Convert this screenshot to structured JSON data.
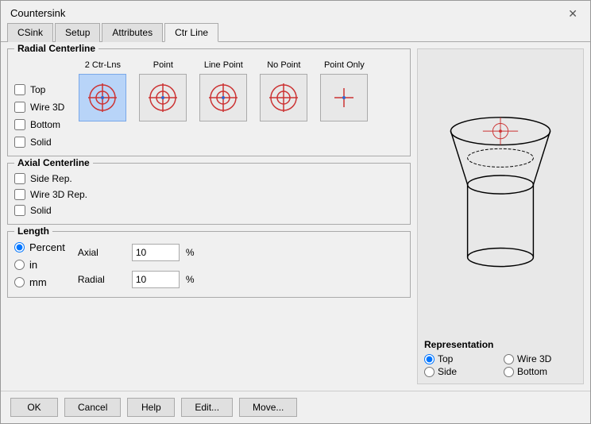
{
  "dialog": {
    "title": "Countersink",
    "close_label": "✕"
  },
  "tabs": [
    {
      "label": "CSink",
      "active": false
    },
    {
      "label": "Setup",
      "active": false
    },
    {
      "label": "Attributes",
      "active": false
    },
    {
      "label": "Ctr Line",
      "active": true
    }
  ],
  "radial_centerline": {
    "group_label": "Radial Centerline",
    "checkboxes": [
      {
        "id": "chk-top",
        "label": "Top",
        "checked": false
      },
      {
        "id": "chk-wire3d",
        "label": "Wire 3D",
        "checked": false
      },
      {
        "id": "chk-bottom",
        "label": "Bottom",
        "checked": false
      },
      {
        "id": "chk-solid",
        "label": "Solid",
        "checked": false
      }
    ],
    "icon_columns": [
      {
        "label": "2 Ctr-Lns",
        "selected": true
      },
      {
        "label": "Point",
        "selected": false
      },
      {
        "label": "Line Point",
        "selected": false
      },
      {
        "label": "No Point",
        "selected": false
      },
      {
        "label": "Point Only",
        "selected": false
      }
    ]
  },
  "axial_centerline": {
    "group_label": "Axial Centerline",
    "checkboxes": [
      {
        "id": "chk-siderep",
        "label": "Side Rep.",
        "checked": false
      },
      {
        "id": "chk-wire3drep",
        "label": "Wire 3D Rep.",
        "checked": false
      },
      {
        "id": "chk-solid2",
        "label": "Solid",
        "checked": false
      }
    ]
  },
  "length": {
    "group_label": "Length",
    "radios": [
      {
        "id": "rad-percent",
        "label": "Percent",
        "checked": true
      },
      {
        "id": "rad-in",
        "label": "in",
        "checked": false
      },
      {
        "id": "rad-mm",
        "label": "mm",
        "checked": false
      }
    ],
    "fields": [
      {
        "label": "Axial",
        "value": "10",
        "unit": "%"
      },
      {
        "label": "Radial",
        "value": "10",
        "unit": "%"
      }
    ]
  },
  "representation": {
    "label": "Representation",
    "radios": [
      {
        "id": "rep-top",
        "label": "Top",
        "checked": true
      },
      {
        "id": "rep-wire3d",
        "label": "Wire 3D",
        "checked": false
      },
      {
        "id": "rep-side",
        "label": "Side",
        "checked": false
      },
      {
        "id": "rep-bottom",
        "label": "Bottom",
        "checked": false
      }
    ]
  },
  "footer": {
    "buttons": [
      {
        "label": "OK",
        "name": "ok-button"
      },
      {
        "label": "Cancel",
        "name": "cancel-button"
      },
      {
        "label": "Help",
        "name": "help-button"
      },
      {
        "label": "Edit...",
        "name": "edit-button"
      },
      {
        "label": "Move...",
        "name": "move-button"
      }
    ]
  }
}
